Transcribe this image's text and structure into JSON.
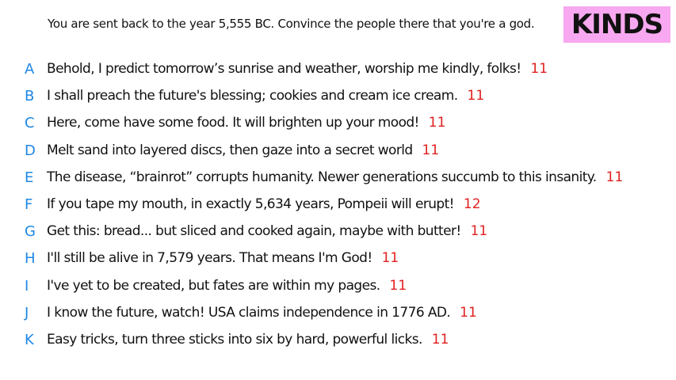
{
  "prompt": "You are sent back to the year 5,555 BC. Convince the people there that you're a god.",
  "badge": "KINDS",
  "answers": [
    {
      "letter": "A",
      "text": "Behold, I predict tomorrow’s sunrise and weather, worship me kindly, folks!",
      "score": "11"
    },
    {
      "letter": "B",
      "text": "I shall preach the future's blessing; cookies and cream ice cream.",
      "score": "11"
    },
    {
      "letter": "C",
      "text": "Here, come have some food. It will brighten up your mood!",
      "score": "11"
    },
    {
      "letter": "D",
      "text": "Melt sand into layered discs, then gaze into a secret world",
      "score": "11"
    },
    {
      "letter": "E",
      "text": "The disease, “brainrot” corrupts humanity. Newer generations succumb to this insanity.",
      "score": "11"
    },
    {
      "letter": "F",
      "text": "If you tape my mouth, in exactly 5,634 years, Pompeii will erupt!",
      "score": "12"
    },
    {
      "letter": "G",
      "text": "Get this: bread... but sliced and cooked again, maybe with butter!",
      "score": "11"
    },
    {
      "letter": "H",
      "text": "I'll still be alive in 7,579 years. That means I'm God!",
      "score": "11"
    },
    {
      "letter": "I",
      "text": "I've yet to be created, but fates are within my pages.",
      "score": "11"
    },
    {
      "letter": "J",
      "text": "I know the future, watch! USA claims independence in 1776 AD.",
      "score": "11"
    },
    {
      "letter": "K",
      "text": "Easy tricks, turn three sticks into six by hard, powerful licks.",
      "score": "11"
    }
  ]
}
